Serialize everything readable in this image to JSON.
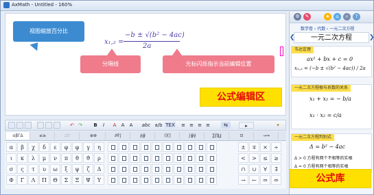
{
  "window": {
    "title": "AxMath - Untitled - 160%"
  },
  "editor": {
    "formula": {
      "lhs": "x₁,₂ =",
      "numerator": "−b ± √(b² − 4ac)",
      "denominator": "2a"
    },
    "callouts": {
      "zoom": "视图缩放百分比",
      "fraction_line": "分隔线",
      "cursor": "光标闪烁指示当前编辑位置"
    },
    "label": "公式编辑区"
  },
  "toolbar": {
    "buttons": [
      "B",
      "I",
      "A",
      "A",
      "A",
      "abc",
      "a/b",
      "TEX",
      "≡",
      "≡",
      "≡",
      "≡",
      "⇆",
      "▸",
      "▾"
    ]
  },
  "palette_tabs": [
    "αβΓΔ",
    "≤≥",
    "∴∵",
    "⊕⊗",
    "∂∇∫",
    "∮∯",
    "()[]",
    "∫∯∮",
    "∑∏∐",
    "⊡",
    "→⇒"
  ],
  "greek_symbols": [
    [
      "α",
      "β",
      "χ",
      "δ",
      "ε",
      "φ",
      "φ",
      "γ",
      "η"
    ],
    [
      "ι",
      "κ",
      "λ",
      "μ",
      "ν",
      "π",
      "θ",
      "ϑ",
      "ρ"
    ],
    [
      "σ",
      "ς",
      "τ",
      "υ",
      "ω",
      "ξ",
      "ψ",
      "ζ",
      "Δ"
    ],
    [
      "Φ",
      "Γ",
      "Λ",
      "Π",
      "Θ",
      "Σ",
      "Ξ",
      "Ψ",
      "Υ"
    ]
  ],
  "operator_symbols": [
    [
      "±",
      "∓",
      "×",
      "÷",
      "≈",
      "≠",
      "=",
      "≡"
    ],
    [
      "<",
      ">",
      "≤",
      "≥",
      "⊂",
      "⊃",
      "∈",
      "∉"
    ],
    [
      "∩",
      "∪",
      "∀",
      "∃",
      "∞",
      "∂",
      "∇",
      "∝"
    ],
    [
      "→",
      "←",
      "⇒",
      "⇔",
      "↔",
      "↑",
      "↓",
      "≅"
    ]
  ],
  "library": {
    "breadcrumb": "数学卷 › 代数 › 一元二次方程",
    "topic": "一元二次方程",
    "cards": [
      {
        "head": "韦达定理",
        "lines": [
          "ax² + bx + c = 0",
          "x₁,₂ = (−b ± √(b² − 4ac)) / 2a"
        ]
      },
      {
        "head": "一元二次方程根与系数的关系",
        "lines": [
          "x₁ + x₂ = − b/a",
          "x₁ · x₂ = c/a"
        ]
      },
      {
        "head": "一元二次方程判别式",
        "lines": [
          "Δ = b² − 4ac",
          "Δ > 0  方程有两个不相等的实根",
          "Δ = 0  方程有两个相等的实根"
        ]
      }
    ],
    "label": "公式库"
  }
}
